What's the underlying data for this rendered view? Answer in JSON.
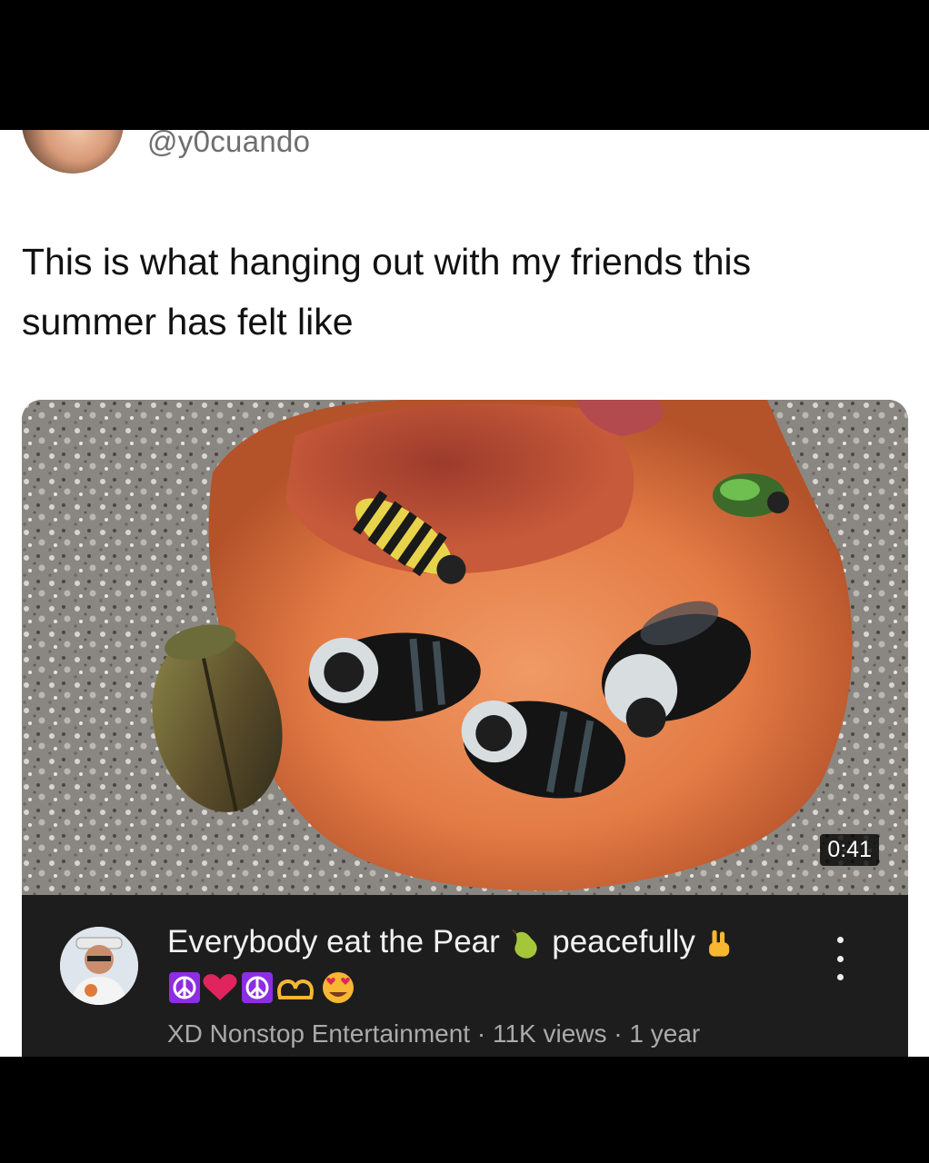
{
  "tweet": {
    "handle": "@y0cuando",
    "text": "This is what hanging out with my friends this summer has felt like"
  },
  "video": {
    "duration": "0:41",
    "title_part1": "Everybody eat the Pear",
    "title_part2": "peacefully",
    "channel": "XD Nonstop Entertainment",
    "views": "11K views",
    "age": "1 year",
    "separator": " · "
  },
  "icons": {
    "pear": "pear-icon",
    "peace_hand": "victory-hand-icon",
    "more": "vertical-ellipsis-icon"
  },
  "colors": {
    "info_bg": "#1d1d1d",
    "peace_box": "#8e2de2",
    "heart": "#e0245e"
  }
}
